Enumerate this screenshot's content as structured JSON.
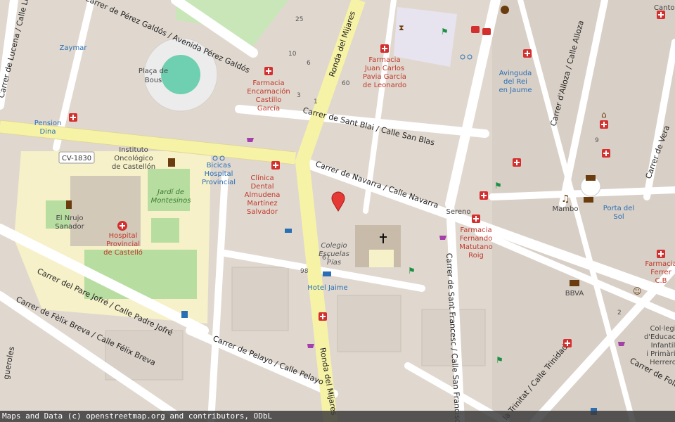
{
  "map": {
    "streets": {
      "perez_galdos": "Carrer de Pérez Galdós / Avenida Pérez Galdós",
      "lucena": "Carrer de Lucena / Calle Lucena",
      "ronda_mijares_top": "Ronda del Mijares",
      "ronda_mijares_bottom": "Ronda del Mijares",
      "sant_blai": "Carrer de Sant Blai / Calle San Blas",
      "navarra": "Carrer de Navarra / Calle Navarra",
      "pare_jofre": "Carrer del Pare Jofré / Calle Padre Jofré",
      "felix_breva": "Carrer de Fèlix Breva / Calle Félix Breva",
      "pelayo": "Carrer de Pelayo / Calle Pelayo",
      "sant_francesc": "Carrer de Sant Francesc / Calle San Francisco",
      "trinitat": "la Trinitat / Calle Trinidad",
      "alloza": "Carrer d'Alloza / Calle Alloza",
      "vera": "Carrer de Vera",
      "fola": "Carrer de Fola",
      "cv1830": "CV-1830",
      "gueroles": "gueroles",
      "avinguda_rei": [
        "Avinguda",
        "del Rei",
        "en Jaume"
      ],
      "canton": "Canton"
    },
    "places": {
      "placa_bous": [
        "Plaça de",
        "Bous"
      ],
      "zaymar": "Zaymar",
      "pension_dina": [
        "Pension",
        "Dina"
      ],
      "instituto": [
        "Instituto",
        "Oncológico",
        "de Castellón"
      ],
      "bicicas": [
        "Bicicas",
        "Hospital",
        "Provincial"
      ],
      "jardi": [
        "Jardí de",
        "Montesinos"
      ],
      "nrujo": [
        "El Nrujo",
        "Sanador"
      ],
      "hospital": [
        "Hospital",
        "Provincial",
        "de Castelló"
      ],
      "clinica": [
        "Clínica",
        "Dental",
        "Almudena",
        "Martínez",
        "Salvador"
      ],
      "farmacia_enc": [
        "Farmacia",
        "Encarnación",
        "Castillo",
        "García"
      ],
      "farmacia_juan": [
        "Farmacia",
        "Juan Carlos",
        "Pavia García",
        "de Leonardo"
      ],
      "farmacia_fer": [
        "Farmacia",
        "Fernando",
        "Matutano",
        "Roig"
      ],
      "farmacia_ferrer": [
        "Farmacia",
        "Ferrer",
        "C.B"
      ],
      "colegio": [
        "Colegio",
        "Escuelas",
        "Pías"
      ],
      "hotel": "Hotel Jaime",
      "sereno": "Sereno",
      "mambo": "Mambo",
      "porta_sol": [
        "Porta del",
        "Sol"
      ],
      "bbva": "BBVA",
      "colegi": [
        "Col·legi",
        "d'Educació",
        "Infantil",
        "i Primària",
        "Herrero"
      ]
    },
    "house_numbers": [
      "25",
      "10",
      "6",
      "3",
      "1",
      "60",
      "67",
      "98",
      "9",
      "2"
    ],
    "marker_color": "#e53935"
  },
  "attribution": "Maps and Data (c) openstreetmap.org and contributors, ODbL"
}
